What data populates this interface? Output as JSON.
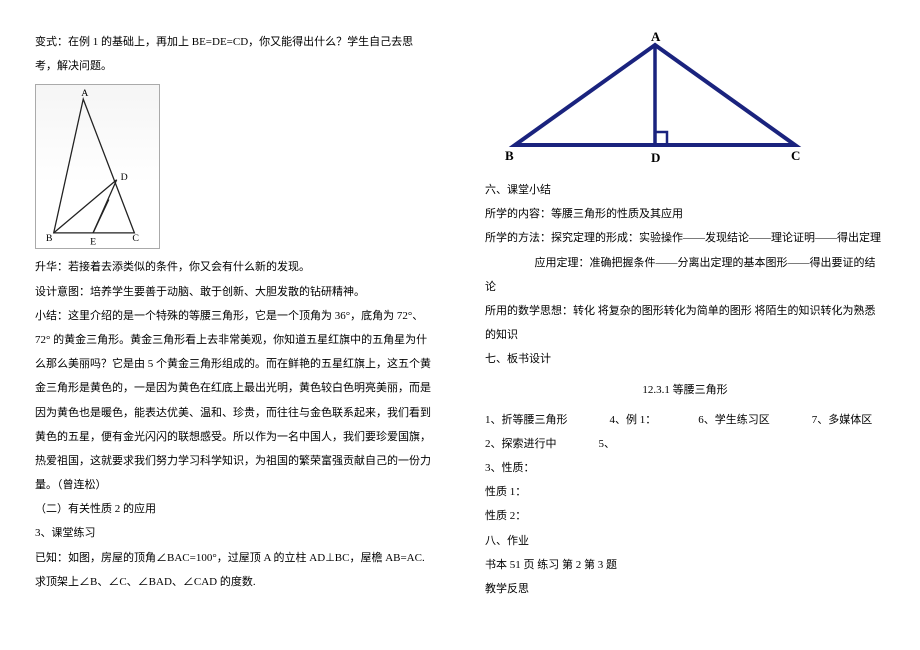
{
  "left": {
    "p1": "变式：在例 1 的基础上，再加上 BE=DE=CD，你又能得出什么？学生自己去思考，解决问题。",
    "fig1_labels": {
      "A": "A",
      "B": "B",
      "C": "C",
      "D": "D",
      "E": "E"
    },
    "p2": "升华：若接着去添类似的条件，你又会有什么新的发现。",
    "p3": "设计意图：培养学生要善于动脑、敢于创新、大胆发散的钻研精神。",
    "p4": "小结：这里介绍的是一个特殊的等腰三角形，它是一个顶角为 36°，底角为 72°、72° 的黄金三角形。黄金三角形看上去非常美观，你知道五星红旗中的五角星为什么那么美丽吗？它是由 5 个黄金三角形组成的。而在鲜艳的五星红旗上，这五个黄金三角形是黄色的，一是因为黄色在红底上最出光明，黄色较白色明亮美丽，而是因为黄色也是暖色，能表达优美、温和、珍贵，而往往与金色联系起来，我们看到黄色的五星，便有金光闪闪的联想感受。所以作为一名中国人，我们要珍爱国旗，热爱祖国，这就要求我们努力学习科学知识，为祖国的繁荣富强贡献自己的一份力量。（曾连松）",
    "p5": "（二）有关性质 2 的应用",
    "p6": "3、课堂练习",
    "p7": "已知：如图，房屋的顶角∠BAC=100°，过屋顶 A 的立柱 AD⊥BC，屋檐 AB=AC. 求顶架上∠B、∠C、∠BAD、∠CAD 的度数."
  },
  "right": {
    "tri_labels": {
      "A": "A",
      "B": "B",
      "C": "C",
      "D": "D"
    },
    "h6": "六、课堂小结",
    "r1": "所学的内容：等腰三角形的性质及其应用",
    "r2": "所学的方法：探究定理的形成：实验操作——发现结论——理论证明——得出定理",
    "r2b": "应用定理：准确把握条件——分离出定理的基本图形——得出要证的结论",
    "r3": "所用的数学思想：转化  将复杂的图形转化为简单的图形  将陌生的知识转化为熟悉的知识",
    "h7": "七、板书设计",
    "boardTitle": "12.3.1  等腰三角形",
    "b1a": "1、折等腰三角形",
    "b1b": "4、例 1：",
    "b1c": "6、学生练习区",
    "b1d": "7、多媒体区",
    "b2a": "2、探索进行中",
    "b2b": "5、",
    "b3": "3、性质：",
    "b4": "性质 1：",
    "b5": "性质 2：",
    "h8": "八、作业",
    "r4": "书本 51 页    练习    第 2 第 3 题",
    "r5": "教学反思"
  }
}
